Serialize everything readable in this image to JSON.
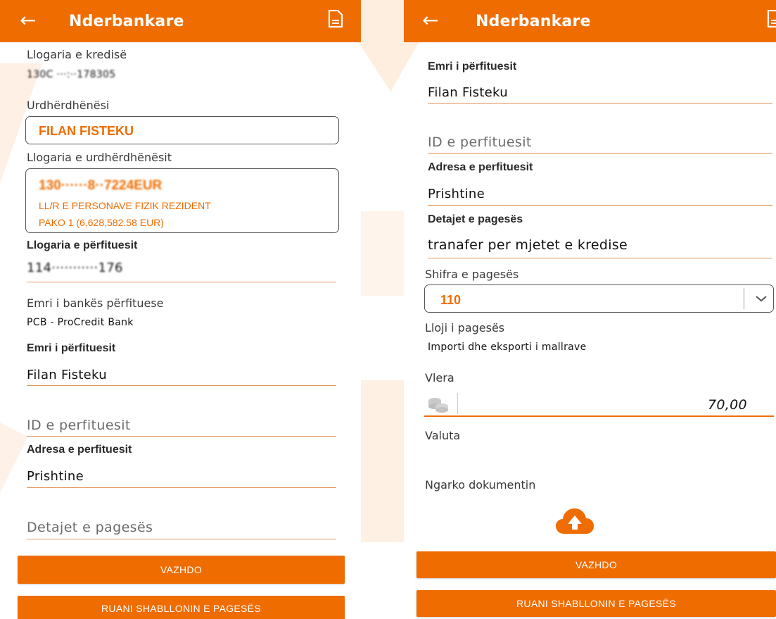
{
  "theme": {
    "accent": "#ef6c00",
    "background": "#ffffff"
  },
  "left": {
    "header": {
      "back_icon": "arrow-left-icon",
      "title": "Nderbankare",
      "doc_icon": "document-icon"
    },
    "credit_account": {
      "label": "Llogaria e kredisë",
      "value": "130C ···:··178305"
    },
    "ordering_party": {
      "label": "Urdhërdhënësi",
      "value": "FILAN FISTEKU"
    },
    "ordering_account": {
      "label": "Llogaria e urdhërdhënësit",
      "number": "130······8··7224EUR",
      "type": "LL/R E PERSONAVE FIZIK REZIDENT",
      "package": "PAKO 1 (6,628,582.58 EUR)"
    },
    "beneficiary_account": {
      "label": "Llogaria e përfituesit",
      "value": "114···········176"
    },
    "beneficiary_bank": {
      "label": "Emri i bankës përfituese",
      "value": "PCB - ProCredit Bank"
    },
    "beneficiary_name": {
      "label": "Emri i përfituesit",
      "value": "Filan Fisteku"
    },
    "beneficiary_id": {
      "placeholder": "ID e perfituesit"
    },
    "beneficiary_address": {
      "label": "Adresa e perfituesit",
      "value": "Prishtine"
    },
    "payment_details": {
      "placeholder": "Detajet e pagesës"
    },
    "buttons": {
      "continue": "VAZHDO",
      "save_template": "RUANI SHABLLONIN E PAGESËS"
    }
  },
  "right": {
    "header": {
      "back_icon": "arrow-left-icon",
      "title": "Nderbankare",
      "doc_icon": "document-icon"
    },
    "beneficiary_name": {
      "label": "Emri i përfituesit",
      "value": "Filan Fisteku"
    },
    "beneficiary_id": {
      "placeholder": "ID e perfituesit"
    },
    "beneficiary_address": {
      "label": "Adresa e perfituesit",
      "value": "Prishtine"
    },
    "payment_details": {
      "label": "Detajet e pagesës",
      "value": "tranafer per mjetet e kredise"
    },
    "payment_code": {
      "label": "Shifra e pagesës",
      "value": "110"
    },
    "payment_type": {
      "label": "Lloji i pagesës",
      "value": "Importi dhe eksporti i mallrave"
    },
    "amount": {
      "label": "Vlera",
      "value": "70,00",
      "icon": "coins-icon"
    },
    "currency": {
      "label": "Valuta"
    },
    "upload": {
      "label": "Ngarko dokumentin",
      "icon": "cloud-upload-icon"
    },
    "buttons": {
      "continue": "VAZHDO",
      "save_template": "RUANI SHABLLONIN E PAGESËS"
    }
  }
}
